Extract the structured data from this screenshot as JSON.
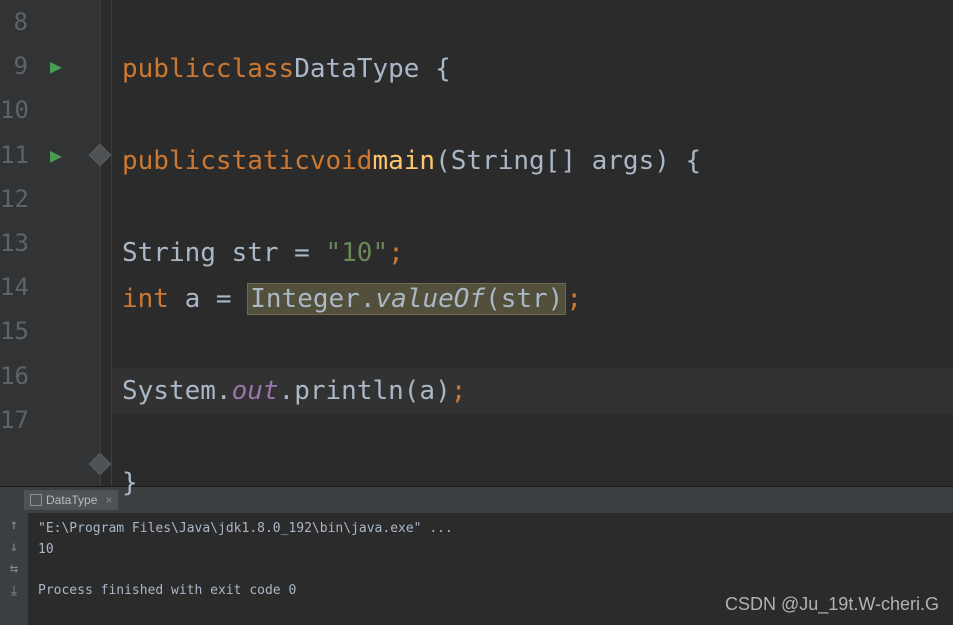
{
  "lines": {
    "n8": "8",
    "n9": "9",
    "n10": "10",
    "n11": "11",
    "n12": "12",
    "n13": "13",
    "n14": "14",
    "n15": "15",
    "n16": "16",
    "n17": "17"
  },
  "code": {
    "l9_public": "public",
    "l9_class": "class",
    "l9_name": "DataType",
    "l9_brace": " {",
    "l11_public": "public",
    "l11_static": "static",
    "l11_void": "void",
    "l11_main": "main",
    "l11_params": "(String[] args) {",
    "l13_type": "String str = ",
    "l13_str": "\"10\"",
    "l14_int": "int",
    "l14_var": " a = ",
    "l14_integer": "Integer.",
    "l14_valueof": "valueOf",
    "l14_args": "(str)",
    "l16_system": "System.",
    "l16_out": "out",
    "l16_println": ".println(a)",
    "l18_brace": "}",
    "semi": ";"
  },
  "console": {
    "tab_name": "DataType",
    "output_line1": "\"E:\\Program Files\\Java\\jdk1.8.0_192\\bin\\java.exe\" ...",
    "output_line2": "10",
    "output_line3": "",
    "output_line4": "Process finished with exit code 0"
  },
  "watermark": "CSDN @Ju_19t.W-cheri.G"
}
